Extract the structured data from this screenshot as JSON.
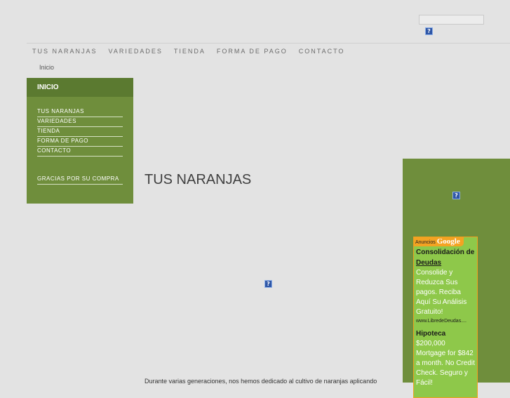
{
  "header": {
    "search_value": "",
    "icon_glyph": "?"
  },
  "topnav": {
    "items": [
      "TUS NARANJAS",
      "VARIEDADES",
      "TIENDA",
      "FORMA DE PAGO",
      "CONTACTO"
    ]
  },
  "breadcrumb": {
    "label": "Inicio"
  },
  "sidebar": {
    "title": "INICIO",
    "items": [
      "TUS NARANJAS",
      "VARIEDADES",
      "TIENDA",
      "FORMA DE PAGO",
      "CONTACTO"
    ],
    "extra": "GRACIAS POR SU COMPRA"
  },
  "main": {
    "title": "TUS NARANJAS",
    "body_text": "Durante varias generaciones, nos hemos dedicado al cultivo de naranjas aplicando"
  },
  "ads": {
    "badge_prefix": "Anuncios",
    "badge_brand": "Google",
    "ad1": {
      "title_line1": "Consolidación de",
      "title_line2": "Deudas",
      "text": "Consolide y Reduzca Sus pagos. Reciba Aquí Su Análisis Gratuito!",
      "url": "www.LibredeDeudas...."
    },
    "ad2": {
      "title": "Hipoteca",
      "text": "$200,000 Mortgage for $842 a month. No Credit Check. Seguro y Fácil!"
    }
  },
  "colors": {
    "green_panel": "#6f8e3c",
    "green_header": "#5b7a30",
    "ad_background": "#8ec84a",
    "ad_badge": "#f3a322",
    "page_background": "#e3e3e3"
  },
  "icons": {
    "broken_image": "broken-image-icon"
  }
}
